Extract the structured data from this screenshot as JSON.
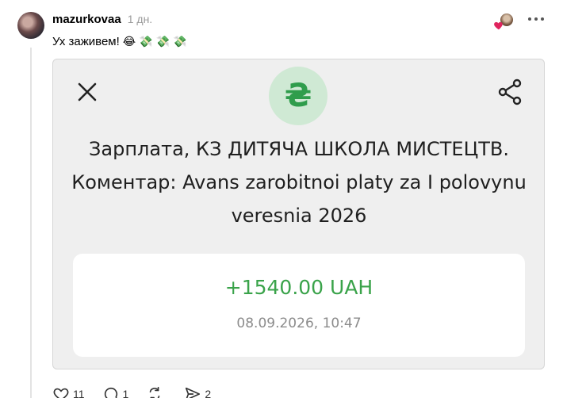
{
  "post": {
    "username": "mazurkovaa",
    "time": "1 дн.",
    "text": "Ух заживем!",
    "emojis": [
      "😂",
      "💸",
      "💸",
      "💸"
    ]
  },
  "card": {
    "currency_symbol": "₴",
    "title": "Зарплата, КЗ  ДИТЯЧА ШКОЛА МИСТЕЦТВ. Коментар: Avans zarobitnoi platy za I polovynu veresnia 2026",
    "amount": "+1540.00 UAH",
    "datetime": "08.09.2026, 10:47"
  },
  "actions": {
    "likes": "11",
    "comments": "1",
    "reposts": "",
    "shares": "2"
  },
  "colors": {
    "accent_green": "#3aa34a",
    "heart_red": "#e0245e",
    "card_bg": "#efefef"
  },
  "icons": [
    "close-icon",
    "share-icon",
    "more-icon",
    "heart-icon",
    "comment-icon",
    "repost-icon",
    "send-icon"
  ]
}
